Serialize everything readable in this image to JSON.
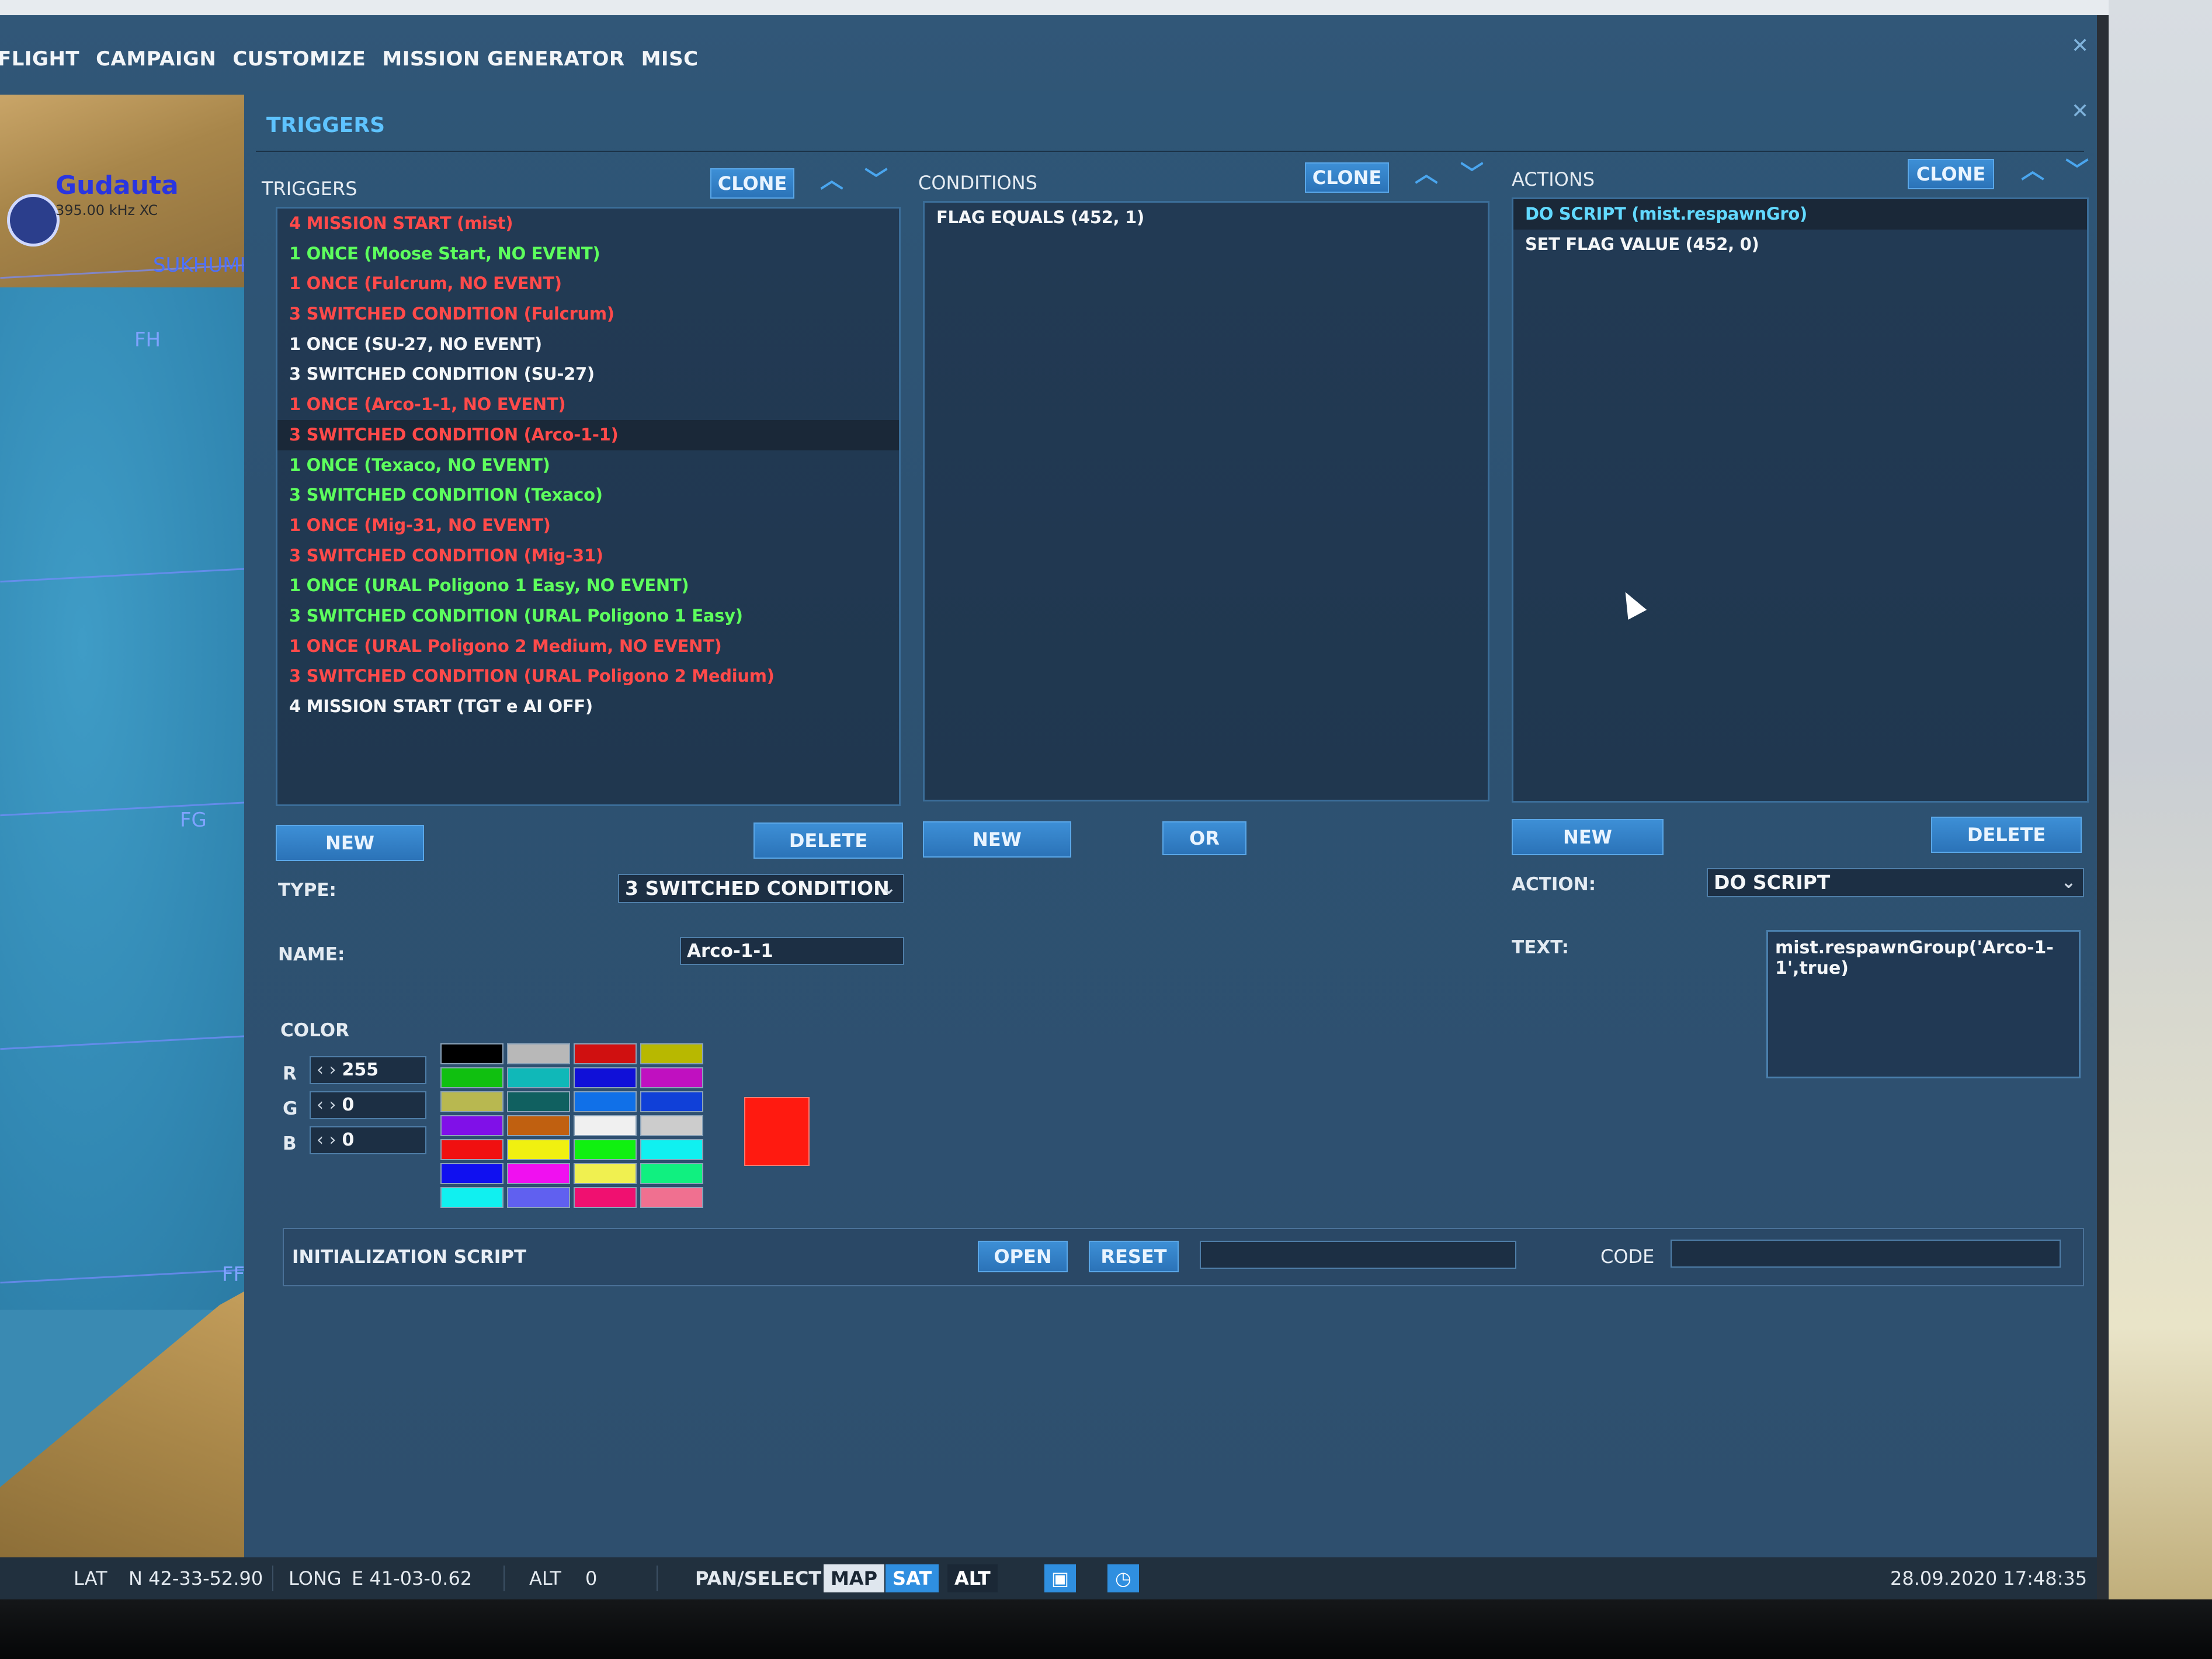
{
  "menu": {
    "items": [
      "FLIGHT",
      "CAMPAIGN",
      "CUSTOMIZE",
      "MISSION GENERATOR",
      "MISC"
    ]
  },
  "map": {
    "airfield_name": "Gudauta",
    "airfield_freq": "395.00 kHz XC",
    "city_label": "SUKHUMI",
    "grid_labels": [
      "FH",
      "FG",
      "FF"
    ]
  },
  "window": {
    "title": "TRIGGERS"
  },
  "triggers": {
    "header": "TRIGGERS",
    "clone_label": "CLONE",
    "items": [
      {
        "label": "4 MISSION START (mist)",
        "color": "red"
      },
      {
        "label": "1 ONCE (Moose Start, NO EVENT)",
        "color": "green"
      },
      {
        "label": "1 ONCE (Fulcrum, NO EVENT)",
        "color": "red"
      },
      {
        "label": "3 SWITCHED CONDITION (Fulcrum)",
        "color": "red"
      },
      {
        "label": "1 ONCE (SU-27, NO EVENT)",
        "color": "white"
      },
      {
        "label": "3 SWITCHED CONDITION (SU-27)",
        "color": "white"
      },
      {
        "label": "1 ONCE (Arco-1-1, NO EVENT)",
        "color": "red"
      },
      {
        "label": "3 SWITCHED CONDITION (Arco-1-1)",
        "color": "red"
      },
      {
        "label": "1 ONCE (Texaco, NO EVENT)",
        "color": "green"
      },
      {
        "label": "3 SWITCHED CONDITION (Texaco)",
        "color": "green"
      },
      {
        "label": "1 ONCE (Mig-31, NO EVENT)",
        "color": "red"
      },
      {
        "label": "3 SWITCHED CONDITION (Mig-31)",
        "color": "red"
      },
      {
        "label": "1 ONCE (URAL Poligono 1 Easy, NO EVENT)",
        "color": "green"
      },
      {
        "label": "3 SWITCHED CONDITION (URAL Poligono 1 Easy)",
        "color": "green"
      },
      {
        "label": "1 ONCE (URAL Poligono 2 Medium, NO EVENT)",
        "color": "red"
      },
      {
        "label": "3 SWITCHED CONDITION (URAL Poligono 2 Medium)",
        "color": "red"
      },
      {
        "label": "4 MISSION START (TGT e AI OFF)",
        "color": "white"
      }
    ],
    "selected_index": 7,
    "new_label": "NEW",
    "delete_label": "DELETE",
    "type_label": "TYPE:",
    "type_value": "3 SWITCHED CONDITION",
    "name_label": "NAME:",
    "name_value": "Arco-1-1",
    "color_label": "COLOR",
    "r_label": "R",
    "r_value": "255",
    "g_label": "G",
    "g_value": "0",
    "b_label": "B",
    "b_value": "0",
    "current_color": "#ff1a10",
    "palette": [
      "#000000",
      "#b8b8b8",
      "#d01010",
      "#b8b800",
      "#10c010",
      "#10b8b8",
      "#1010d8",
      "#c010c0",
      "#b8b850",
      "#106060",
      "#1070e8",
      "#1040d8",
      "#8010e8",
      "#c06010",
      "#f0f0f0",
      "#cccccc",
      "#f01010",
      "#f0f010",
      "#10f010",
      "#10f0f0",
      "#1010f0",
      "#f010f0",
      "#f0f050",
      "#10f080",
      "#10f0f0",
      "#6060f0",
      "#f01070",
      "#f07090"
    ]
  },
  "conditions": {
    "header": "CONDITIONS",
    "clone_label": "CLONE",
    "items": [
      "FLAG EQUALS (452, 1)"
    ],
    "new_label": "NEW",
    "or_label": "OR"
  },
  "actions": {
    "header": "ACTIONS",
    "clone_label": "CLONE",
    "items": [
      {
        "label": "DO SCRIPT (mist.respawnGro)",
        "color": "cyan"
      },
      {
        "label": "SET FLAG VALUE (452, 0)",
        "color": "white"
      }
    ],
    "selected_index": 0,
    "new_label": "NEW",
    "delete_label": "DELETE",
    "action_label": "ACTION:",
    "action_value": "DO SCRIPT",
    "text_label": "TEXT:",
    "text_value": "mist.respawnGroup('Arco-1-1',true)"
  },
  "init_script": {
    "label": "INITIALIZATION SCRIPT",
    "open_label": "OPEN",
    "reset_label": "RESET",
    "code_label": "CODE",
    "file_value": "",
    "code_value": ""
  },
  "status": {
    "lat_label": "LAT",
    "lat_value": "N 42-33-52.90",
    "long_label": "LONG",
    "long_value": "E 41-03-0.62",
    "alt_label": "ALT",
    "alt_value": "0",
    "pan_select": "PAN/SELECT",
    "map_btn": "MAP",
    "sat_btn": "SAT",
    "alt_btn": "ALT",
    "datetime": "28.09.2020 17:48:35"
  },
  "colors": {
    "accent": "#5ec3ff",
    "button": "#2b73b8",
    "red": "#ff4a4a",
    "green": "#5dff5d"
  }
}
